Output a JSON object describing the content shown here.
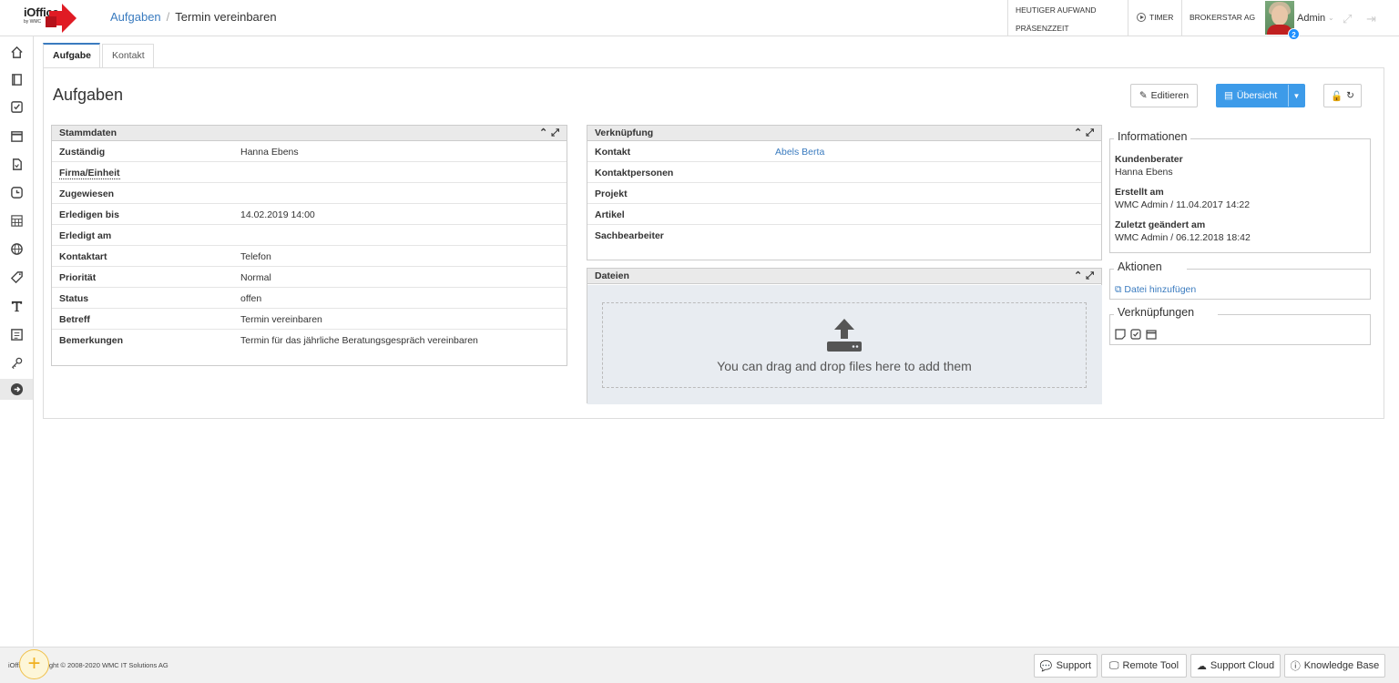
{
  "header": {
    "logo_text": "iOffice",
    "logo_sub": "by WMC",
    "breadcrumb_link": "Aufgaben",
    "breadcrumb_sep": "/",
    "breadcrumb_current": "Termin vereinbaren",
    "aufwand_label": "HEUTIGER AUFWAND",
    "praesenz_label": "PRÄSENZZEIT",
    "timer_label": "TIMER",
    "broker_label": "BROKERSTAR AG",
    "user_name": "Admin",
    "notification_count": "2"
  },
  "tabs": [
    {
      "label": "Aufgabe"
    },
    {
      "label": "Kontakt"
    }
  ],
  "page": {
    "title": "Aufgaben",
    "edit_label": "Editieren",
    "overview_label": "Übersicht"
  },
  "stammdaten": {
    "title": "Stammdaten",
    "rows": [
      {
        "key": "Zuständig",
        "value": "Hanna Ebens"
      },
      {
        "key": "Firma/Einheit",
        "value": ""
      },
      {
        "key": "Zugewiesen",
        "value": ""
      },
      {
        "key": "Erledigen bis",
        "value": "14.02.2019 14:00"
      },
      {
        "key": "Erledigt am",
        "value": ""
      },
      {
        "key": "Kontaktart",
        "value": "Telefon"
      },
      {
        "key": "Priorität",
        "value": "Normal"
      },
      {
        "key": "Status",
        "value": "offen"
      },
      {
        "key": "Betreff",
        "value": "Termin vereinbaren"
      },
      {
        "key": "Bemerkungen",
        "value": "Termin für das jährliche Beratungsgespräch vereinbaren"
      }
    ]
  },
  "verknuepfung": {
    "title": "Verknüpfung",
    "rows": [
      {
        "key": "Kontakt",
        "value": "Abels Berta"
      },
      {
        "key": "Kontaktpersonen",
        "value": ""
      },
      {
        "key": "Projekt",
        "value": ""
      },
      {
        "key": "Artikel",
        "value": ""
      },
      {
        "key": "Sachbearbeiter",
        "value": ""
      }
    ]
  },
  "dateien": {
    "title": "Dateien",
    "dropzone_text": "You can drag and drop files here to add them"
  },
  "informationen": {
    "title": "Informationen",
    "kundenberater_label": "Kundenberater",
    "kundenberater_value": "Hanna Ebens",
    "erstellt_label": "Erstellt am",
    "erstellt_value": "WMC Admin / 11.04.2017 14:22",
    "geaendert_label": "Zuletzt geändert am",
    "geaendert_value": "WMC Admin / 06.12.2018 18:42"
  },
  "aktionen": {
    "title": "Aktionen",
    "add_file_label": "Datei hinzufügen"
  },
  "verknuepfungen": {
    "title": "Verknüpfungen"
  },
  "footer": {
    "copyright": "iOffice Copyright © 2008-2020 WMC IT Solutions AG",
    "support_label": "Support",
    "remote_label": "Remote Tool",
    "cloud_label": "Support Cloud",
    "kb_label": "Knowledge Base"
  }
}
